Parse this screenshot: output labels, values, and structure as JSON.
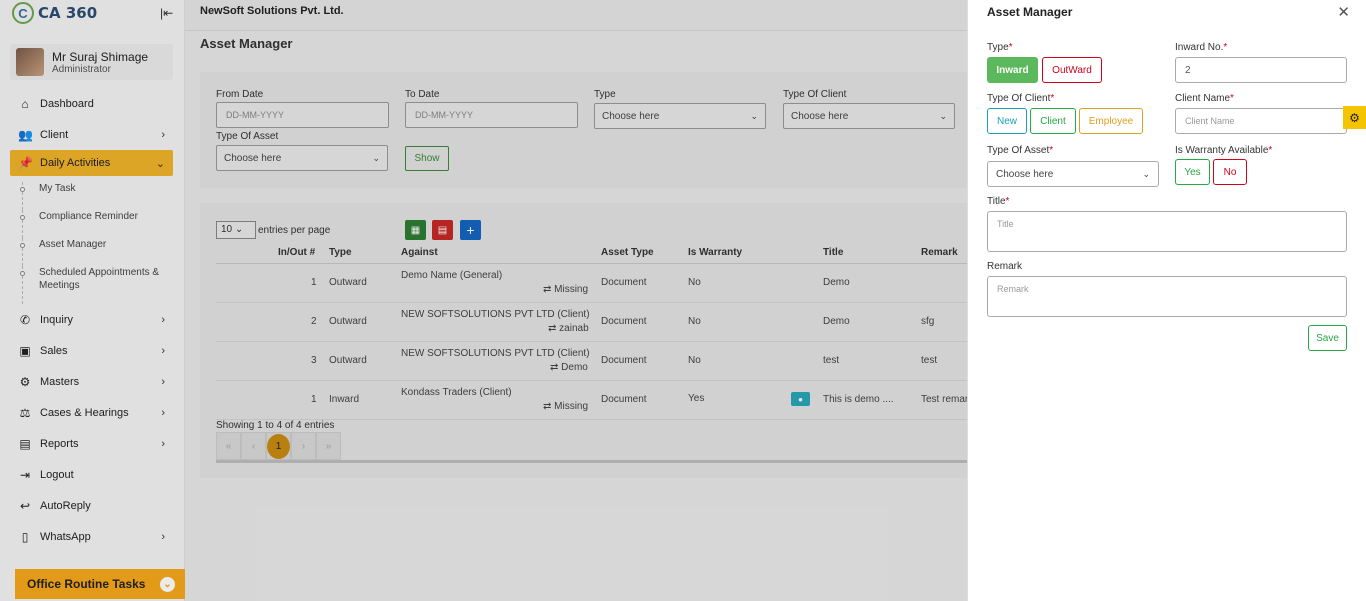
{
  "sidebar": {
    "logo_text": "CA 360",
    "profile": {
      "name": "Mr Suraj Shimage",
      "role": "Administrator"
    },
    "items": [
      {
        "label": "Dashboard"
      },
      {
        "label": "Client"
      },
      {
        "label": "Daily Activities"
      },
      {
        "label": "Inquiry"
      },
      {
        "label": "Sales"
      },
      {
        "label": "Masters"
      },
      {
        "label": "Cases & Hearings"
      },
      {
        "label": "Reports"
      },
      {
        "label": "Logout"
      },
      {
        "label": "AutoReply"
      },
      {
        "label": "WhatsApp"
      }
    ],
    "sub_items": [
      {
        "label": "My Task"
      },
      {
        "label": "Compliance Reminder"
      },
      {
        "label": "Asset Manager"
      },
      {
        "label": "Scheduled Appointments & Meetings"
      }
    ],
    "office_tasks": "Office Routine Tasks"
  },
  "header": {
    "company": "NewSoft Solutions Pvt. Ltd."
  },
  "main": {
    "title": "Asset Manager",
    "filters": {
      "from_date_label": "From Date",
      "from_date_placeholder": "DD-MM-YYYY",
      "to_date_label": "To Date",
      "to_date_placeholder": "DD-MM-YYYY",
      "type_label": "Type",
      "type_value": "Choose here",
      "client_type_label": "Type Of Client",
      "client_type_value": "Choose here",
      "asset_type_label": "Type Of Asset",
      "asset_type_value": "Choose here",
      "show_label": "Show"
    },
    "table": {
      "entries_value": "10",
      "entries_label": "entries per page",
      "headers": [
        "In/Out #",
        "Type",
        "Against",
        "Asset Type",
        "Is Warranty",
        "Title",
        "Remark"
      ],
      "rows": [
        {
          "num": "1",
          "type": "Outward",
          "against": "Demo Name (General)",
          "sub": "⇄ Missing",
          "asset": "Document",
          "warranty": "No",
          "title": "Demo",
          "remark": ""
        },
        {
          "num": "2",
          "type": "Outward",
          "against": "NEW SOFTSOLUTIONS PVT LTD (Client)",
          "sub": "⇄ zainab",
          "asset": "Document",
          "warranty": "No",
          "title": "Demo",
          "remark": "sfg"
        },
        {
          "num": "3",
          "type": "Outward",
          "against": "NEW SOFTSOLUTIONS PVT LTD (Client)",
          "sub": "⇄ Demo",
          "asset": "Document",
          "warranty": "No",
          "title": "test",
          "remark": "test"
        },
        {
          "num": "1",
          "type": "Inward",
          "against": "Kondass Traders (Client)",
          "sub": "⇄ Missing",
          "asset": "Document",
          "warranty": "Yes",
          "title": "This is demo ....",
          "remark": "Test remar"
        }
      ],
      "showing": "Showing 1 to 4 of 4 entries",
      "pager": [
        "«",
        "‹",
        "1",
        "›",
        "»"
      ]
    }
  },
  "panel": {
    "title": "Asset Manager",
    "type_label": "Type",
    "inward_label": "Inward",
    "outward_label": "OutWard",
    "inward_no_label": "Inward No.",
    "inward_no_value": "2",
    "client_type_label": "Type Of Client",
    "new_label": "New",
    "client_label": "Client",
    "employee_label": "Employee",
    "client_name_label": "Client Name",
    "client_name_placeholder": "Client Name",
    "asset_type_label": "Type Of Asset",
    "asset_type_value": "Choose here",
    "warranty_label": "Is Warranty Available",
    "yes_label": "Yes",
    "no_label": "No",
    "title_label": "Title",
    "title_placeholder": "Title",
    "remark_label": "Remark",
    "remark_placeholder": "Remark",
    "save_label": "Save",
    "required_mark": "*"
  },
  "colors": {
    "accent": "#f0b429",
    "inward_green": "#5cb85c",
    "outward_red": "#d0021b",
    "new_cyan": "#17a2b8",
    "employee_orange": "#e0a020"
  }
}
